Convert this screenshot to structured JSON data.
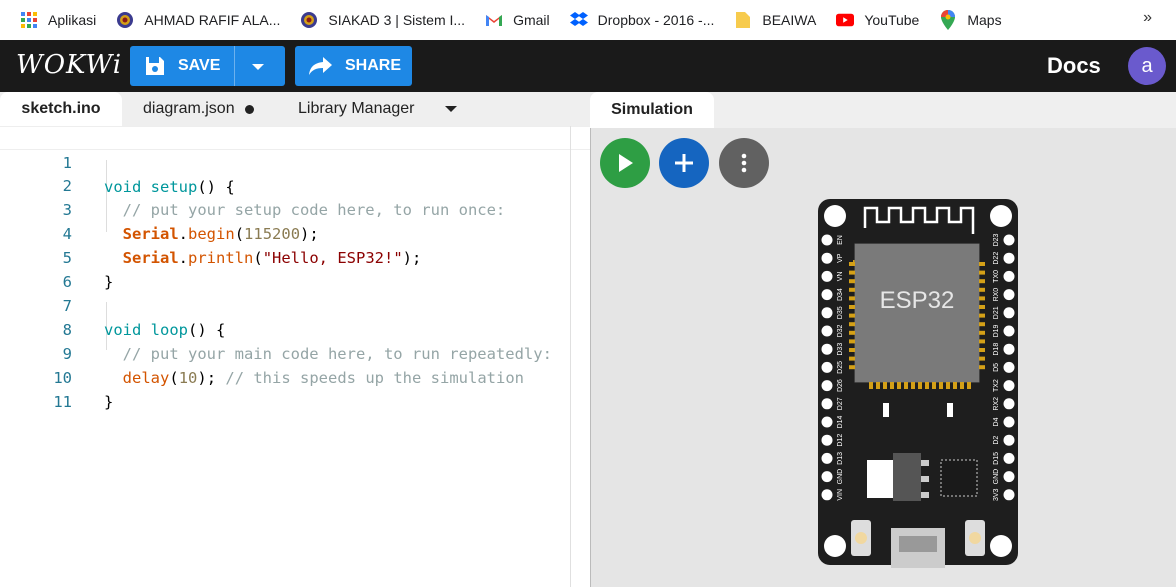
{
  "bookmarks": [
    {
      "label": "Aplikasi",
      "icon": "apps-grid-icon"
    },
    {
      "label": "AHMAD RAFIF ALA...",
      "icon": "university-seal-icon"
    },
    {
      "label": "SIAKAD 3 | Sistem I...",
      "icon": "university-seal-icon"
    },
    {
      "label": "Gmail",
      "icon": "gmail-icon"
    },
    {
      "label": "Dropbox - 2016 -...",
      "icon": "dropbox-icon"
    },
    {
      "label": "BEAIWA",
      "icon": "folder-icon"
    },
    {
      "label": "YouTube",
      "icon": "youtube-icon"
    },
    {
      "label": "Maps",
      "icon": "maps-pin-icon"
    }
  ],
  "bookmarks_more": "»",
  "header": {
    "logo": "WOKWi",
    "save_label": "SAVE",
    "share_label": "SHARE",
    "docs_label": "Docs",
    "avatar_letter": "a"
  },
  "editor": {
    "tabs": [
      {
        "label": "sketch.ino",
        "active": true
      },
      {
        "label": "diagram.json",
        "dirty": true
      },
      {
        "label": "Library Manager"
      }
    ],
    "line_numbers": [
      "1",
      "2",
      "3",
      "4",
      "5",
      "6",
      "7",
      "8",
      "9",
      "10",
      "11"
    ],
    "code": {
      "l1_kw": "void",
      "l1_fn": "setup",
      "l1_rest": "() {",
      "l2": "  // put your setup code here, to run once:",
      "l3_cls": "Serial",
      "l3_meth": "begin",
      "l3_num": "115200",
      "l3_end": ");",
      "l4_cls": "Serial",
      "l4_meth": "println",
      "l4_str": "\"Hello, ESP32!\"",
      "l4_end": ");",
      "l5": "}",
      "l7_kw": "void",
      "l7_fn": "loop",
      "l7_rest": "() {",
      "l8": "  // put your main code here, to run repeatedly:",
      "l9_meth": "delay",
      "l9_num": "10",
      "l9_cm": "// this speeds up the simulation",
      "l10": "}"
    }
  },
  "simulation": {
    "tab_label": "Simulation",
    "chip_label": "ESP32",
    "left_pins": [
      "EN",
      "VP",
      "VN",
      "D34",
      "D35",
      "D32",
      "D33",
      "D25",
      "D26",
      "D27",
      "D14",
      "D12",
      "D13",
      "GND",
      "VIN"
    ],
    "right_pins": [
      "D23",
      "D22",
      "TX0",
      "RX0",
      "D21",
      "D19",
      "D18",
      "D5",
      "TX2",
      "RX2",
      "D4",
      "D2",
      "D15",
      "GND",
      "3V3"
    ]
  },
  "colors": {
    "accent": "#1e88e5",
    "play": "#2e9e44",
    "add": "#1565c0",
    "more": "#616161",
    "board": "#222222"
  }
}
